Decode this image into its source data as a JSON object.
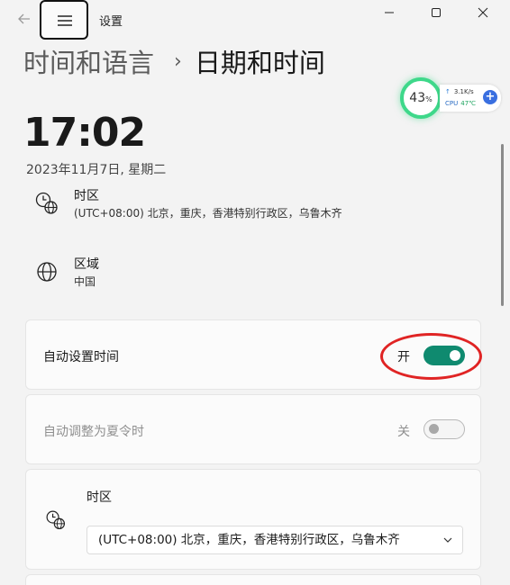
{
  "window": {
    "title": "设置"
  },
  "breadcrumb": {
    "parent": "时间和语言",
    "separator": "›",
    "current": "日期和时间"
  },
  "widget": {
    "percent": "43",
    "percent_unit": "%",
    "net_speed": "3.1K/s",
    "net_arrow": "↑",
    "cpu_label": "CPU",
    "cpu_temp": "47℃",
    "plus": "+"
  },
  "clock": {
    "time": "17:02",
    "date": "2023年11月7日, 星期二"
  },
  "timezone_info": {
    "title": "时区",
    "value": "(UTC+08:00) 北京，重庆，香港特别行政区，乌鲁木齐"
  },
  "region_info": {
    "title": "区域",
    "value": "中国"
  },
  "auto_time": {
    "label": "自动设置时间",
    "state": "开",
    "on": true
  },
  "auto_dst": {
    "label": "自动调整为夏令时",
    "state": "关",
    "on": false
  },
  "timezone_card": {
    "label": "时区",
    "selected": "(UTC+08:00) 北京，重庆，香港特别行政区，乌鲁木齐"
  },
  "colors": {
    "accent": "#0f8a6f",
    "highlight": "#e02424",
    "gauge": "#3ed88a"
  }
}
